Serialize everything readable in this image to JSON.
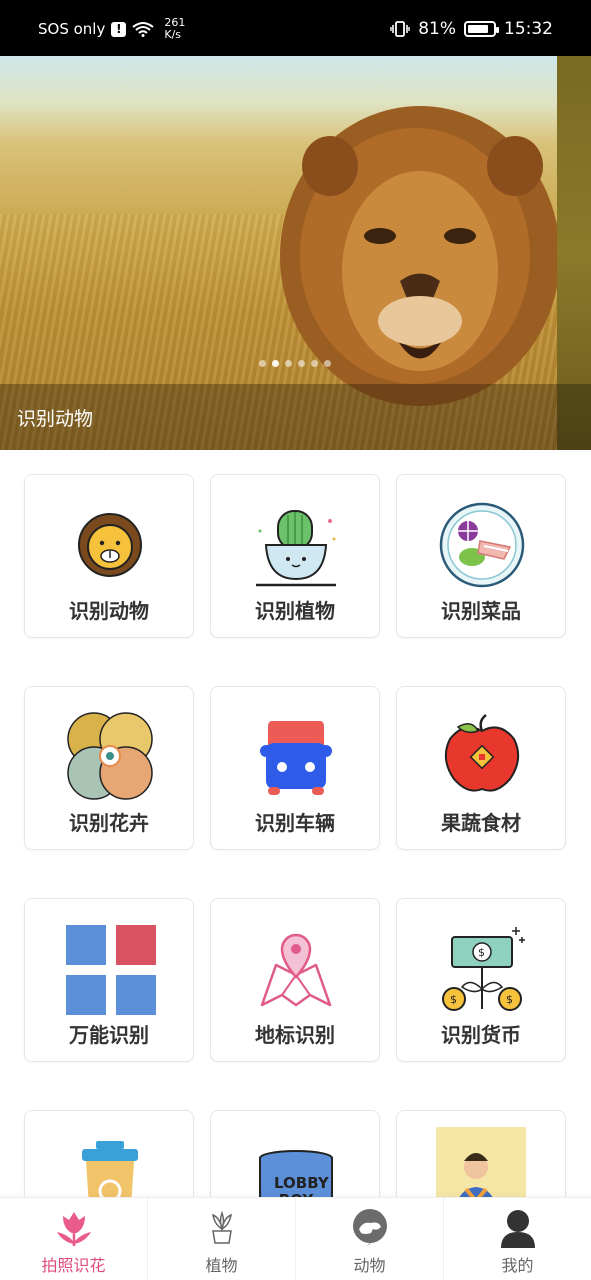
{
  "status_bar": {
    "carrier": "SOS only",
    "net_speed_value": "261",
    "net_speed_unit": "K/s",
    "battery": "81%",
    "time": "15:32"
  },
  "banner": {
    "caption": "识别动物",
    "slide_count": 6,
    "active_slide": 2
  },
  "features": [
    {
      "label": "识别动物",
      "icon": "lion-icon"
    },
    {
      "label": "识别植物",
      "icon": "cactus-icon"
    },
    {
      "label": "识别菜品",
      "icon": "dish-icon"
    },
    {
      "label": "识别花卉",
      "icon": "flower-icon"
    },
    {
      "label": "识别车辆",
      "icon": "car-icon"
    },
    {
      "label": "果蔬食材",
      "icon": "apple-icon"
    },
    {
      "label": "万能识别",
      "icon": "grid-icon"
    },
    {
      "label": "地标识别",
      "icon": "landmark-map-icon"
    },
    {
      "label": "识别货币",
      "icon": "currency-icon"
    },
    {
      "label": "",
      "icon": "trash-bin-icon"
    },
    {
      "label": "",
      "icon": "lobby-boy-icon"
    },
    {
      "label": "",
      "icon": "person-avatar-icon"
    }
  ],
  "lobby_boy_text": "LOBBY BOY",
  "tabs": [
    {
      "label": "拍照识花",
      "icon": "tulip-icon",
      "active": true
    },
    {
      "label": "植物",
      "icon": "potted-plant-icon",
      "active": false
    },
    {
      "label": "动物",
      "icon": "monkey-icon",
      "active": false
    },
    {
      "label": "我的",
      "icon": "user-icon",
      "active": false
    }
  ],
  "colors": {
    "accent": "#e04b7d",
    "tab_inactive": "#666666"
  }
}
